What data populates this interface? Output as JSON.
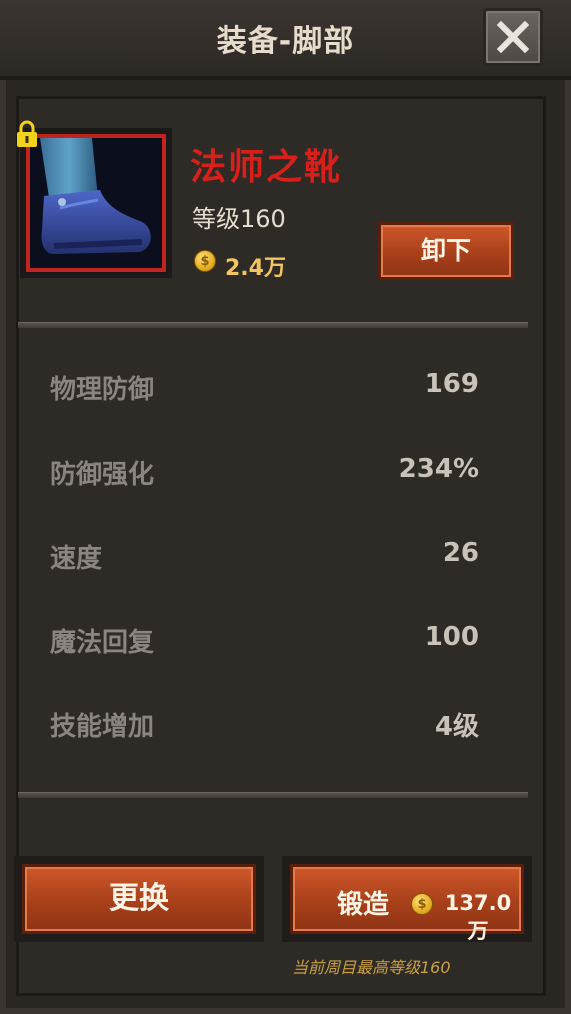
{
  "header": {
    "title": "装备-脚部",
    "close_icon": "close-icon"
  },
  "item": {
    "name": "法师之靴",
    "level_text": "等级160",
    "price": "2.4万",
    "coin_symbol": "$",
    "rarity_color": "#c0241e",
    "locked": true,
    "lock_icon": "lock-icon",
    "image_icon": "boot-icon"
  },
  "actions": {
    "unequip_label": "卸下",
    "swap_label": "更换",
    "forge_label": "锻造",
    "forge_cost": "137.0万"
  },
  "stats": [
    {
      "name": "物理防御",
      "value": "169"
    },
    {
      "name": "防御强化",
      "value": "234%"
    },
    {
      "name": "速度",
      "value": "26"
    },
    {
      "name": "魔法回复",
      "value": "100"
    },
    {
      "name": "技能增加",
      "value": "4级"
    }
  ],
  "footer_note": "当前周目最高等级160"
}
